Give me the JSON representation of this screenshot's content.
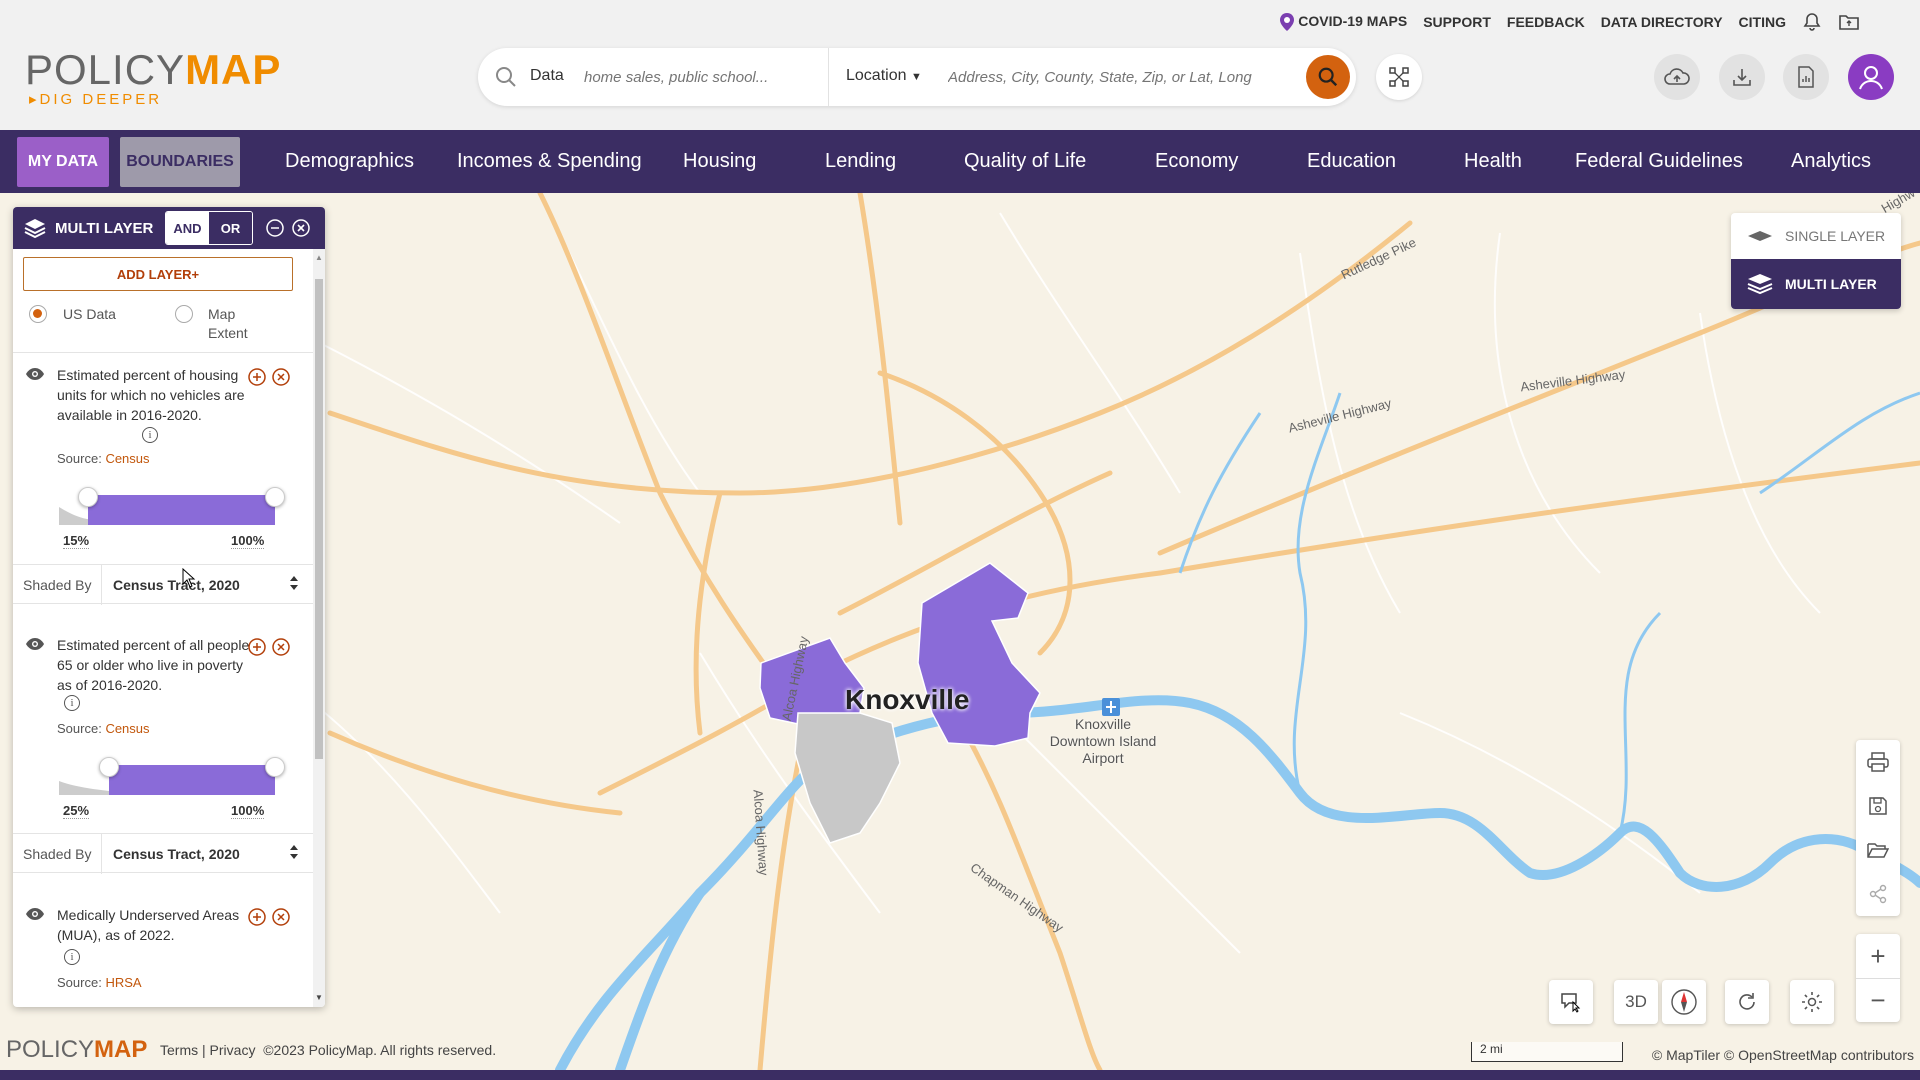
{
  "header": {
    "top_links": [
      "COVID-19 MAPS",
      "SUPPORT",
      "FEEDBACK",
      "DATA DIRECTORY",
      "CITING"
    ],
    "logo_policy": "POLICY",
    "logo_map": "MAP",
    "logo_tagline": "▸DIG DEEPER",
    "search": {
      "data_label": "Data",
      "data_placeholder": "home sales, public school...",
      "location_label": "Location",
      "location_placeholder": "Address, City, County, State, Zip, or Lat, Long"
    }
  },
  "nav": {
    "my_data": "MY DATA",
    "boundaries": "BOUNDARIES",
    "items": [
      "Demographics",
      "Incomes & Spending",
      "Housing",
      "Lending",
      "Quality of Life",
      "Economy",
      "Education",
      "Health",
      "Federal Guidelines",
      "Analytics"
    ]
  },
  "panel": {
    "title": "MULTI LAYER",
    "and_label": "AND",
    "or_label": "OR",
    "add_layer": "ADD LAYER+",
    "radio_us": "US Data",
    "radio_extent": "Map Extent",
    "source_prefix": "Source:",
    "layers": [
      {
        "title": "Estimated percent of housing units for which no vehicles are available in 2016-2020.",
        "source": "Census",
        "min_label": "15%",
        "max_label": "100%",
        "min_value": 15,
        "max_value": 100,
        "shaded_by_label": "Shaded By",
        "shaded_by_value": "Census Tract, 2020"
      },
      {
        "title": "Estimated percent of all people 65 or older who live in poverty as of 2016-2020.",
        "source": "Census",
        "min_label": "25%",
        "max_label": "100%",
        "min_value": 25,
        "max_value": 100,
        "shaded_by_label": "Shaded By",
        "shaded_by_value": "Census Tract, 2020"
      },
      {
        "title": "Medically Underserved Areas (MUA), as of 2022.",
        "source": "HRSA"
      }
    ]
  },
  "layer_toggle": {
    "single": "SINGLE LAYER",
    "multi": "MULTI LAYER"
  },
  "map": {
    "city": "Knoxville",
    "airport": "Knoxville Downtown Island Airport",
    "road_labels": [
      "Rutledge Pike",
      "Asheville Highway",
      "Asheville Highway",
      "Alcoa Highway",
      "Chapman Highway",
      "Alcoa Highway",
      "Highw"
    ],
    "btn_3d": "3D",
    "scale": "2 mi",
    "attribution": "© MapTiler © OpenStreetMap contributors"
  },
  "footer": {
    "logo_policy": "POLICY",
    "logo_map": "MAP",
    "terms": "Terms",
    "privacy": "Privacy",
    "copyright": "©2023 PolicyMap. All rights reserved."
  },
  "colors": {
    "nav_bg": "#3b2d63",
    "accent_orange": "#d3620f",
    "shade_purple": "#8a6bd8",
    "my_data_chip": "#9b5fc8",
    "water": "#8ec8f0",
    "road": "#f5c88a"
  }
}
